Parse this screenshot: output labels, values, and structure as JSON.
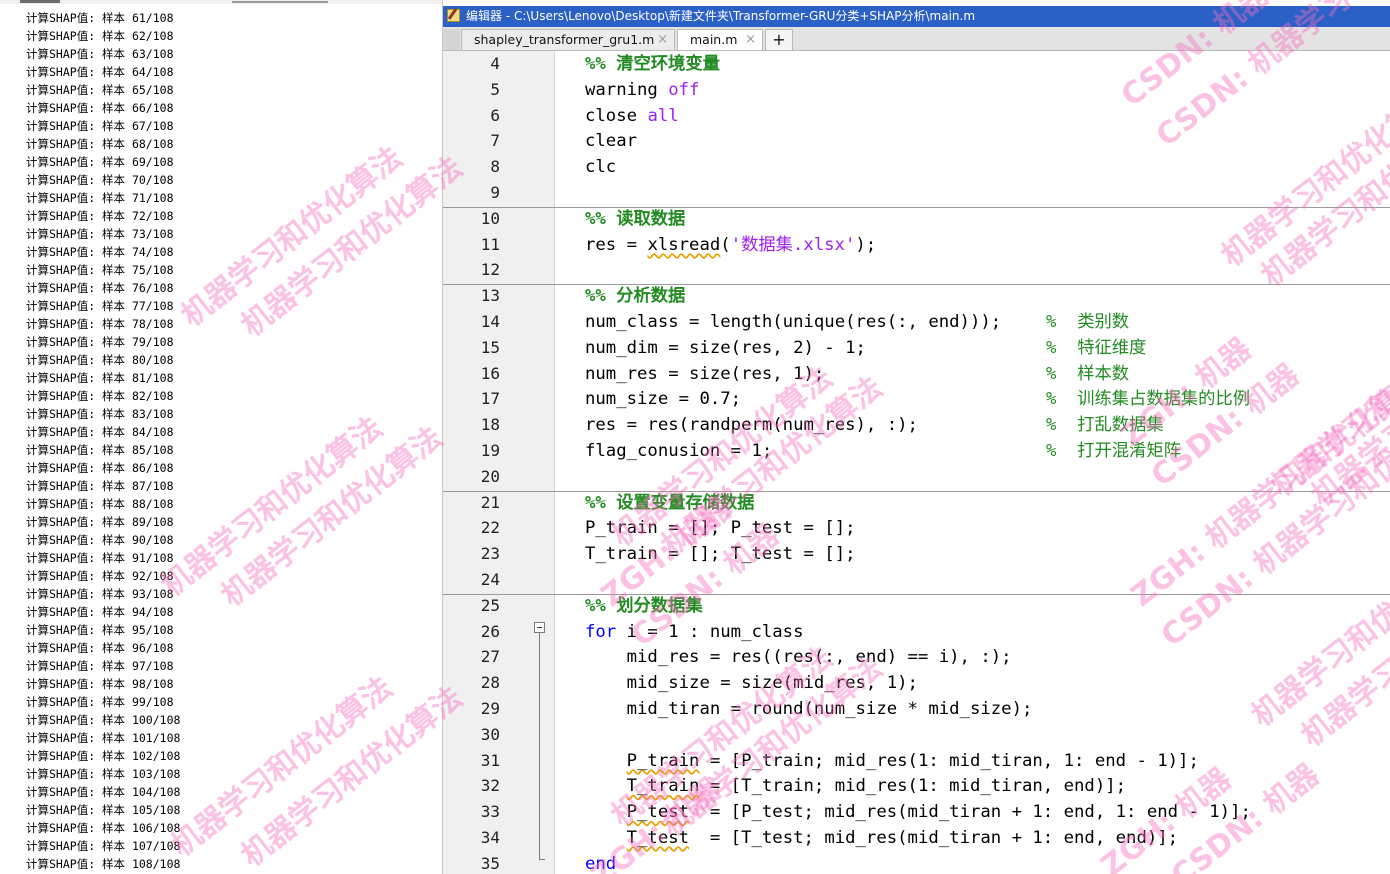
{
  "console": {
    "lines": [
      "计算SHAP值: 样本 61/108",
      "计算SHAP值: 样本 62/108",
      "计算SHAP值: 样本 63/108",
      "计算SHAP值: 样本 64/108",
      "计算SHAP值: 样本 65/108",
      "计算SHAP值: 样本 66/108",
      "计算SHAP值: 样本 67/108",
      "计算SHAP值: 样本 68/108",
      "计算SHAP值: 样本 69/108",
      "计算SHAP值: 样本 70/108",
      "计算SHAP值: 样本 71/108",
      "计算SHAP值: 样本 72/108",
      "计算SHAP值: 样本 73/108",
      "计算SHAP值: 样本 74/108",
      "计算SHAP值: 样本 75/108",
      "计算SHAP值: 样本 76/108",
      "计算SHAP值: 样本 77/108",
      "计算SHAP值: 样本 78/108",
      "计算SHAP值: 样本 79/108",
      "计算SHAP值: 样本 80/108",
      "计算SHAP值: 样本 81/108",
      "计算SHAP值: 样本 82/108",
      "计算SHAP值: 样本 83/108",
      "计算SHAP值: 样本 84/108",
      "计算SHAP值: 样本 85/108",
      "计算SHAP值: 样本 86/108",
      "计算SHAP值: 样本 87/108",
      "计算SHAP值: 样本 88/108",
      "计算SHAP值: 样本 89/108",
      "计算SHAP值: 样本 90/108",
      "计算SHAP值: 样本 91/108",
      "计算SHAP值: 样本 92/108",
      "计算SHAP值: 样本 93/108",
      "计算SHAP值: 样本 94/108",
      "计算SHAP值: 样本 95/108",
      "计算SHAP值: 样本 96/108",
      "计算SHAP值: 样本 97/108",
      "计算SHAP值: 样本 98/108",
      "计算SHAP值: 样本 99/108",
      "计算SHAP值: 样本 100/108",
      "计算SHAP值: 样本 101/108",
      "计算SHAP值: 样本 102/108",
      "计算SHAP值: 样本 103/108",
      "计算SHAP值: 样本 104/108",
      "计算SHAP值: 样本 105/108",
      "计算SHAP值: 样本 106/108",
      "计算SHAP值: 样本 107/108",
      "计算SHAP值: 样本 108/108"
    ]
  },
  "editor": {
    "title": "编辑器 - C:\\Users\\Lenovo\\Desktop\\新建文件夹\\Transformer-GRU分类+SHAP分析\\main.m",
    "tabs": [
      {
        "label": "shapley_transformer_gru1.m",
        "close": "×"
      },
      {
        "label": "main.m",
        "close": "×"
      }
    ],
    "add_tab": "+",
    "lines": [
      {
        "n": "4",
        "segs": [
          {
            "t": "%% 清空环境变量",
            "c": "cell-head"
          }
        ]
      },
      {
        "n": "5",
        "segs": [
          {
            "t": "warning "
          },
          {
            "t": "off",
            "c": "str"
          }
        ]
      },
      {
        "n": "6",
        "segs": [
          {
            "t": "close "
          },
          {
            "t": "all",
            "c": "str"
          }
        ]
      },
      {
        "n": "7",
        "segs": [
          {
            "t": "clear"
          }
        ]
      },
      {
        "n": "8",
        "segs": [
          {
            "t": "clc"
          }
        ]
      },
      {
        "n": "9",
        "segs": []
      },
      {
        "n": "10",
        "segs": [
          {
            "t": "%% 读取数据",
            "c": "cell-head"
          }
        ]
      },
      {
        "n": "11",
        "segs": [
          {
            "t": "res = "
          },
          {
            "t": "xlsread",
            "c": "sq"
          },
          {
            "t": "("
          },
          {
            "t": "'数据集.xlsx'",
            "c": "str"
          },
          {
            "t": ");"
          }
        ]
      },
      {
        "n": "12",
        "segs": []
      },
      {
        "n": "13",
        "segs": [
          {
            "t": "%% 分析数据",
            "c": "cell-head"
          }
        ]
      },
      {
        "n": "14",
        "segs": [
          {
            "t": "num_class = length(unique(res(:, end)));"
          }
        ],
        "comment": "%  类别数"
      },
      {
        "n": "15",
        "segs": [
          {
            "t": "num_dim = size(res, 2) - 1;"
          }
        ],
        "comment": "%  特征维度"
      },
      {
        "n": "16",
        "segs": [
          {
            "t": "num_res = size(res, 1);"
          }
        ],
        "comment": "%  样本数"
      },
      {
        "n": "17",
        "segs": [
          {
            "t": "num_size = 0.7;"
          }
        ],
        "comment": "%  训练集占数据集的比例"
      },
      {
        "n": "18",
        "segs": [
          {
            "t": "res = res(randperm(num_res), :);"
          }
        ],
        "comment": "%  打乱数据集"
      },
      {
        "n": "19",
        "segs": [
          {
            "t": "flag_conusion = 1;"
          }
        ],
        "comment": "%  打开混淆矩阵"
      },
      {
        "n": "20",
        "segs": []
      },
      {
        "n": "21",
        "segs": [
          {
            "t": "%% 设置变量存储数据",
            "c": "cell-head"
          }
        ]
      },
      {
        "n": "22",
        "segs": [
          {
            "t": "P_train = []; P_test = [];"
          }
        ]
      },
      {
        "n": "23",
        "segs": [
          {
            "t": "T_train = []; T_test = [];"
          }
        ]
      },
      {
        "n": "24",
        "segs": []
      },
      {
        "n": "25",
        "segs": [
          {
            "t": "%% 划分数据集",
            "c": "cell-head"
          }
        ]
      },
      {
        "n": "26",
        "segs": [
          {
            "t": "for",
            "c": "kw"
          },
          {
            "t": " i = 1 : num_class"
          }
        ]
      },
      {
        "n": "27",
        "segs": [
          {
            "t": "    mid_res = res((res(:, end) == i), :);"
          }
        ]
      },
      {
        "n": "28",
        "segs": [
          {
            "t": "    mid_size = size(mid_res, 1);"
          }
        ]
      },
      {
        "n": "29",
        "segs": [
          {
            "t": "    mid_tiran = round(num_size * mid_size);"
          }
        ]
      },
      {
        "n": "30",
        "segs": []
      },
      {
        "n": "31",
        "segs": [
          {
            "t": "    "
          },
          {
            "t": "P_train",
            "c": "sq"
          },
          {
            "t": " = [P_train; mid_res(1: mid_tiran, 1: end - 1)];"
          }
        ]
      },
      {
        "n": "32",
        "segs": [
          {
            "t": "    "
          },
          {
            "t": "T_train",
            "c": "sq"
          },
          {
            "t": " = [T_train; mid_res(1: mid_tiran, end)];"
          }
        ]
      },
      {
        "n": "33",
        "segs": [
          {
            "t": "    "
          },
          {
            "t": "P_test",
            "c": "sq"
          },
          {
            "t": "  = [P_test; mid_res(mid_tiran + 1: end, 1: end - 1)];"
          }
        ]
      },
      {
        "n": "34",
        "segs": [
          {
            "t": "    "
          },
          {
            "t": "T_test",
            "c": "sq"
          },
          {
            "t": "  = [T_test; mid_res(mid_tiran + 1: end, end)];"
          }
        ]
      },
      {
        "n": "35",
        "segs": [
          {
            "t": "end",
            "c": "kw"
          }
        ]
      }
    ]
  },
  "watermark": {
    "texts": [
      "机器学习和优化算法",
      "ZGH: 机器",
      "CSDN: 机器",
      "ZGH: 机器学习和优化算法",
      "CSDN: 机器学习和优化算法"
    ]
  }
}
